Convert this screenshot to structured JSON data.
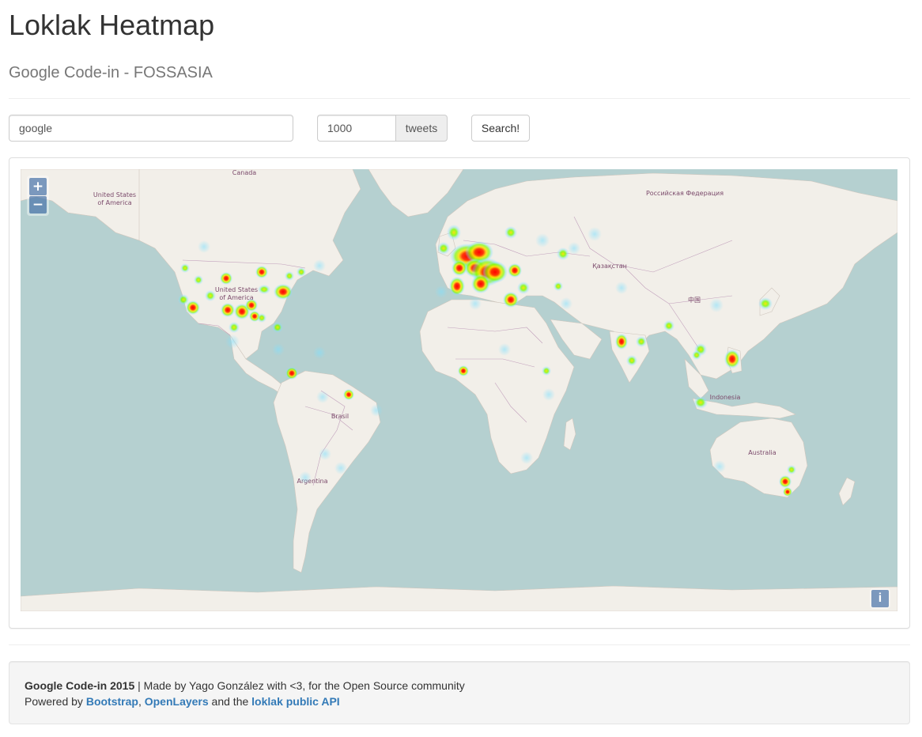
{
  "header": {
    "title": "Loklak Heatmap",
    "subtitle": "Google Code-in - FOSSASIA"
  },
  "search": {
    "query_value": "google",
    "count_value": "1000",
    "count_unit": "tweets",
    "button_label": "Search!"
  },
  "map": {
    "zoom_in_label": "+",
    "zoom_out_label": "−",
    "attribution_label": "i",
    "colors": {
      "ocean": "#b5d0d0",
      "land": "#f2efe9",
      "border": "#b58cb0",
      "heat_low": "#7fe0ff",
      "heat_mid": "#7cfc00",
      "heat_high": "#ff0000"
    },
    "labels": {
      "canada": "Canada",
      "usa_top": "United States",
      "usa_top2": "of America",
      "usa_mid": "United States",
      "usa_mid2": "of America",
      "russia": "Российская Федерация",
      "kazakhstan": "Қазақстан",
      "china": "中国",
      "brasil": "Brasil",
      "argentina": "Argentina",
      "indonesia": "Indonesia",
      "australia": "Australia"
    }
  },
  "footer": {
    "line1_bold": "Google Code-in 2015",
    "line1_rest": " | Made by Yago González with <3, for the Open Source community",
    "line2_prefix": "Powered by ",
    "link_bootstrap": "Bootstrap",
    "sep1": ", ",
    "link_openlayers": "OpenLayers",
    "sep2": " and the ",
    "link_loklak": "loklak public API"
  }
}
